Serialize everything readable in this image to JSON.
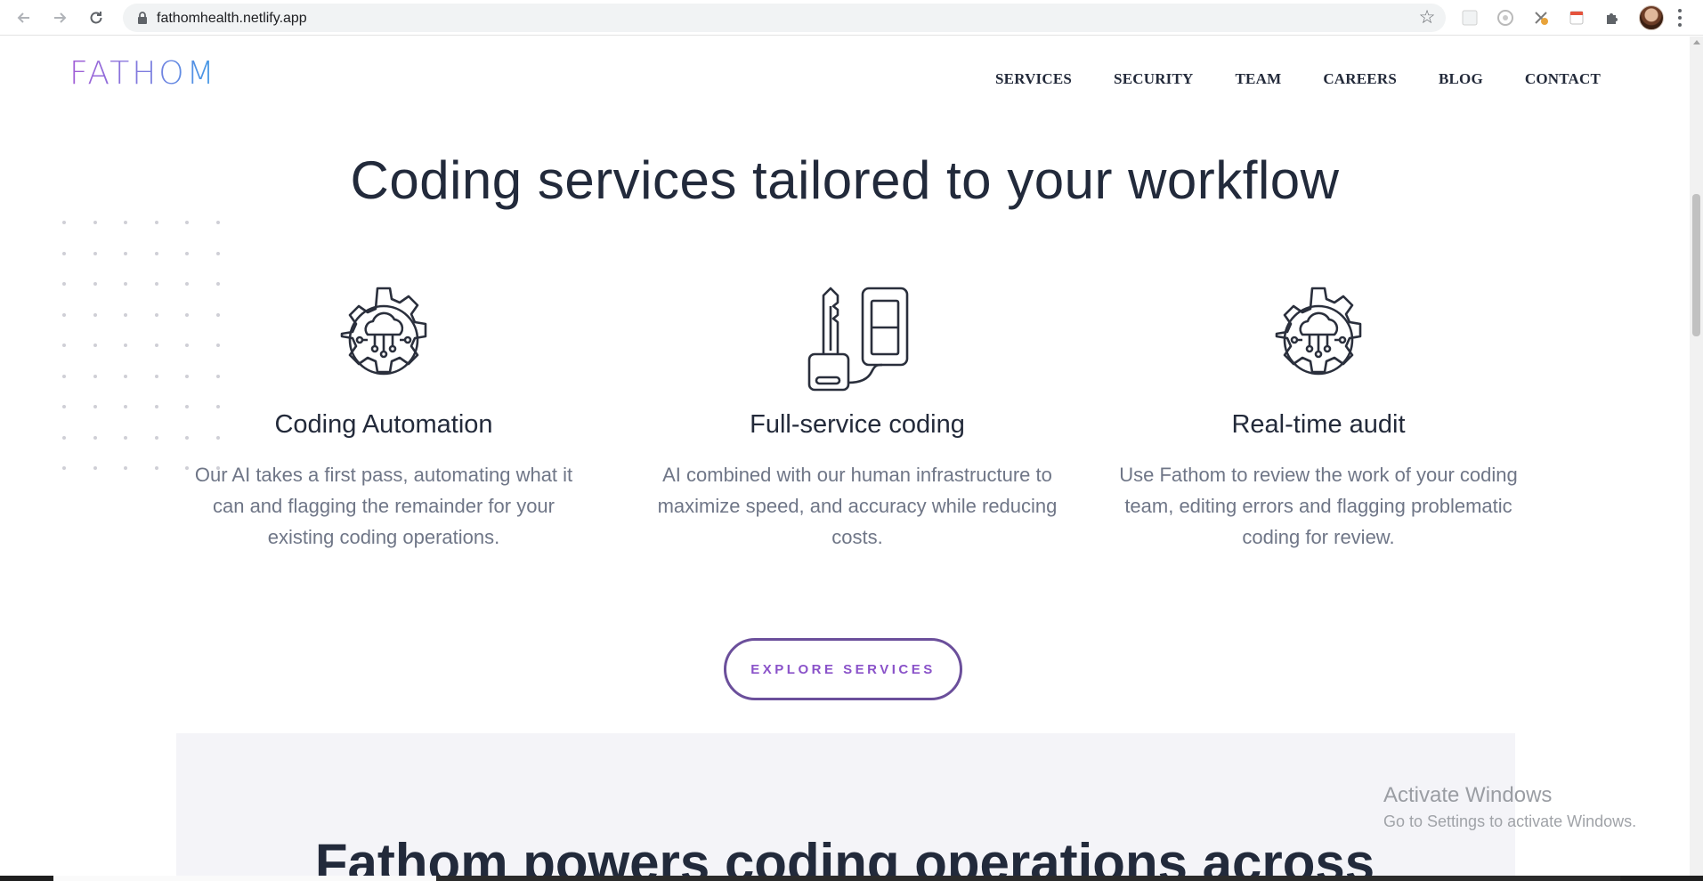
{
  "browser": {
    "url": "fathomhealth.netlify.app"
  },
  "site": {
    "logo": "FATHOM",
    "nav": [
      "SERVICES",
      "SECURITY",
      "TEAM",
      "CAREERS",
      "BLOG",
      "CONTACT"
    ]
  },
  "hero": {
    "heading": "Coding services tailored to your workflow"
  },
  "features": [
    {
      "icon": "cloud-gear-icon",
      "title": "Coding Automation",
      "description": "Our AI takes a first pass, automating what it can and flagging the remainder for your existing coding operations."
    },
    {
      "icon": "key-device-icon",
      "title": "Full-service coding",
      "description": "AI combined with our human infrastructure to maximize speed, and accuracy while reducing costs."
    },
    {
      "icon": "cloud-gear-icon",
      "title": "Real-time audit",
      "description": "Use Fathom to review the work of your coding team, editing errors and flagging problematic coding for review."
    }
  ],
  "cta": {
    "label": "EXPLORE SERVICES"
  },
  "lower": {
    "heading": "Fathom powers coding operations across"
  },
  "watermark": {
    "title": "Activate Windows",
    "subtitle": "Go to Settings to activate Windows."
  },
  "colors": {
    "accent": "#8a52c9",
    "heading": "#222a3b",
    "body_text": "#6f7687",
    "panel": "#f4f4f8"
  }
}
